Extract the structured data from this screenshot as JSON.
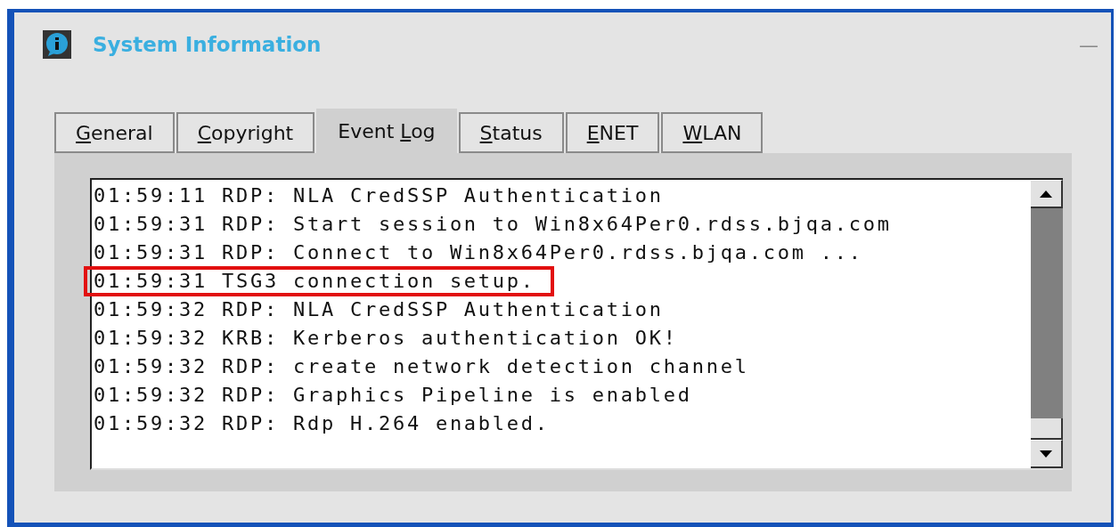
{
  "window": {
    "title": "System Information",
    "minimize": "—"
  },
  "tabs": [
    {
      "key": "G",
      "post": "eneral",
      "selected": false
    },
    {
      "key": "C",
      "post": "opyright",
      "selected": false
    },
    {
      "pre": "Event ",
      "key": "L",
      "post": "og",
      "selected": true
    },
    {
      "key": "S",
      "post": "tatus",
      "selected": false
    },
    {
      "key": "E",
      "post": "NET",
      "selected": false
    },
    {
      "key": "W",
      "post": "LAN",
      "selected": false
    }
  ],
  "log": [
    {
      "text": "01:59:11 RDP: NLA CredSSP Authentication",
      "highlighted": false
    },
    {
      "text": "01:59:31 RDP: Start session to Win8x64Per0.rdss.bjqa.com",
      "highlighted": false
    },
    {
      "text": "01:59:31 RDP: Connect to Win8x64Per0.rdss.bjqa.com ...",
      "highlighted": false
    },
    {
      "text": "01:59:31 TSG3 connection setup.",
      "highlighted": true
    },
    {
      "text": "01:59:32 RDP: NLA CredSSP Authentication",
      "highlighted": false
    },
    {
      "text": "01:59:32 KRB: Kerberos authentication OK!",
      "highlighted": false
    },
    {
      "text": "01:59:32 RDP: create network detection channel",
      "highlighted": false
    },
    {
      "text": "01:59:32 RDP: Graphics Pipeline is enabled",
      "highlighted": false
    },
    {
      "text": "01:59:32 RDP: Rdp H.264 enabled.",
      "highlighted": false
    }
  ]
}
